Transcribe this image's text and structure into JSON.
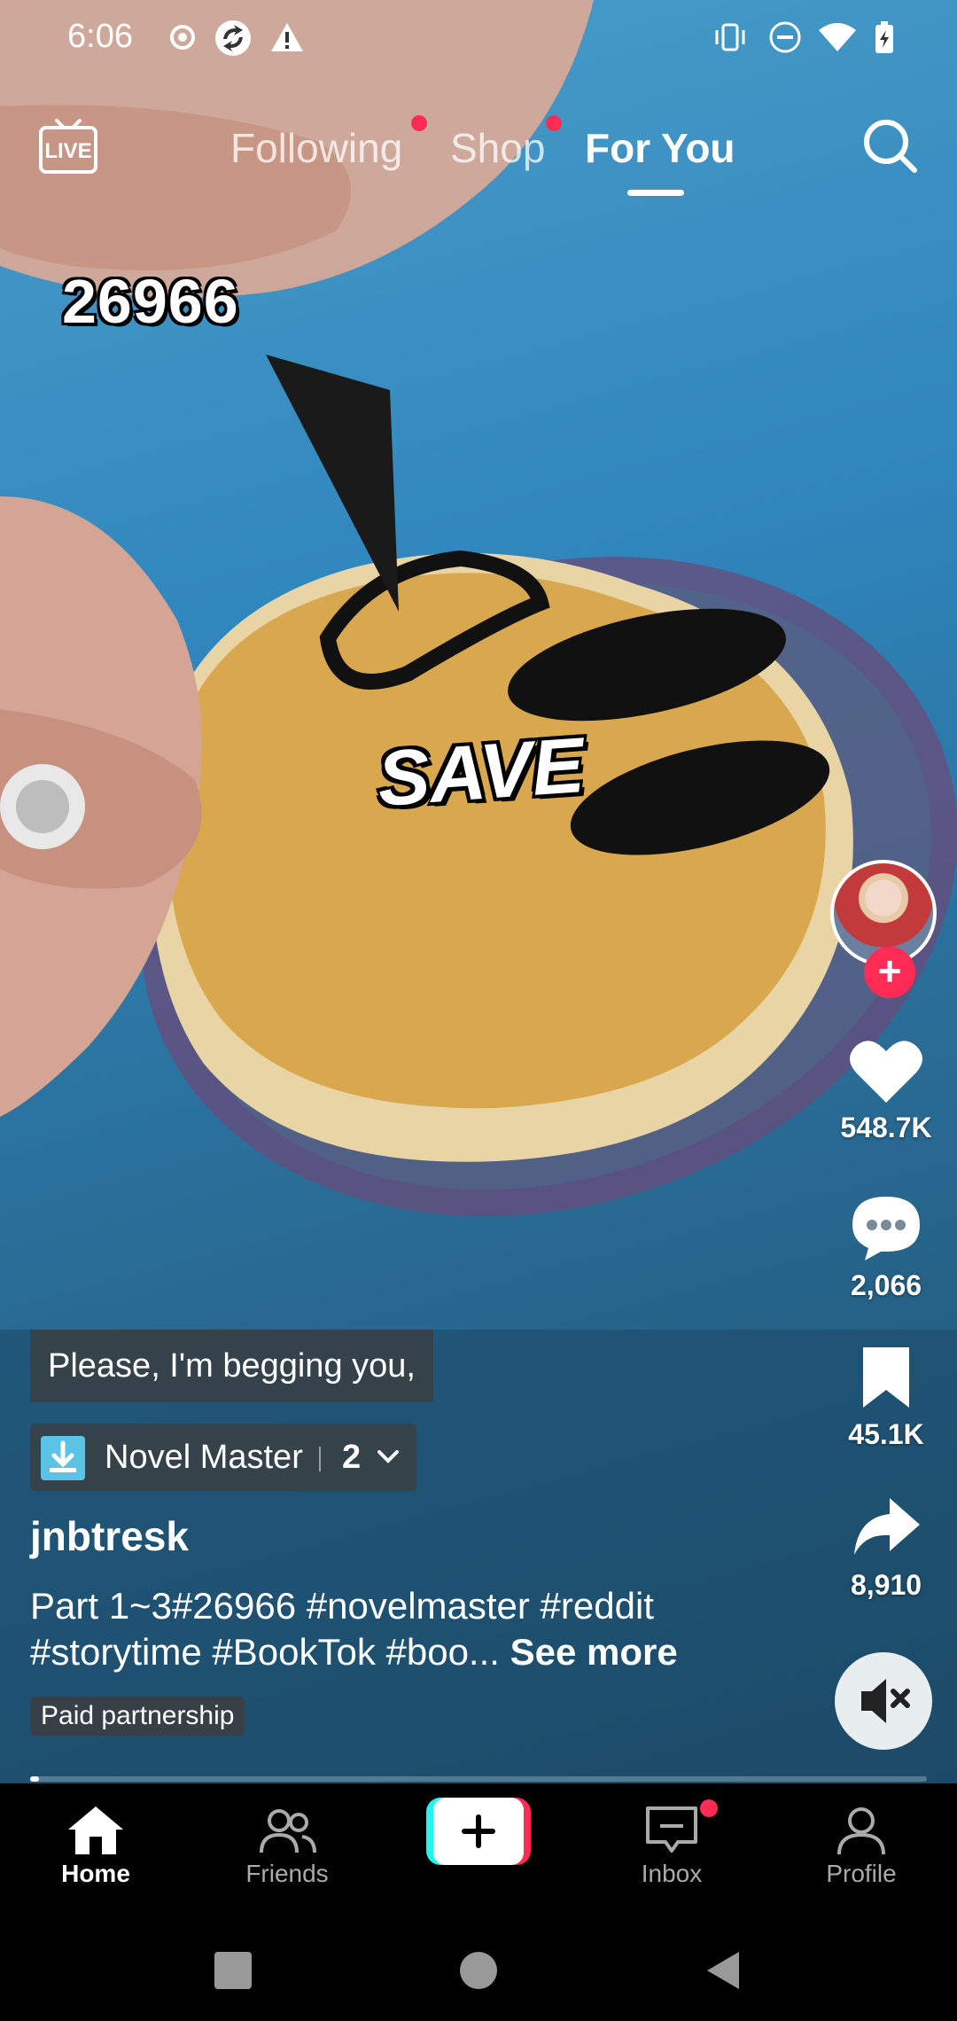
{
  "status_bar": {
    "time": "6:06",
    "icons": [
      "record-icon",
      "sync-icon",
      "warning-icon",
      "vibrate-icon",
      "dnd-icon",
      "wifi-icon",
      "battery-icon"
    ]
  },
  "top_nav": {
    "live_label": "LIVE",
    "tabs": [
      {
        "label": "Following",
        "has_dot": true
      },
      {
        "label": "Shop",
        "has_dot": true
      },
      {
        "label": "For You",
        "active": true
      }
    ]
  },
  "video": {
    "overlay_number": "26966",
    "overlay_text": "SAVE"
  },
  "rail": {
    "likes": "548.7K",
    "comments": "2,066",
    "saves": "45.1K",
    "shares": "8,910"
  },
  "caption": {
    "subtitle": "Please, I'm begging you,",
    "anchor_name": "Novel Master",
    "anchor_count": "2",
    "username": "jnbtresk",
    "desc_line1": "Part 1~3#26966 #novelmaster #reddit",
    "desc_line2": "#storytime #BookTok #boo...",
    "see_more": "See more",
    "paid_label": "Paid partnership",
    "progress": 0.01
  },
  "bottom_nav": {
    "items": [
      {
        "label": "Home",
        "active": true
      },
      {
        "label": "Friends"
      },
      {
        "label": "Inbox",
        "has_dot": true
      },
      {
        "label": "Profile"
      }
    ]
  },
  "colors": {
    "accent": "#fe2c55",
    "create_cyan": "#25f4ee",
    "create_red": "#fe2c55"
  }
}
